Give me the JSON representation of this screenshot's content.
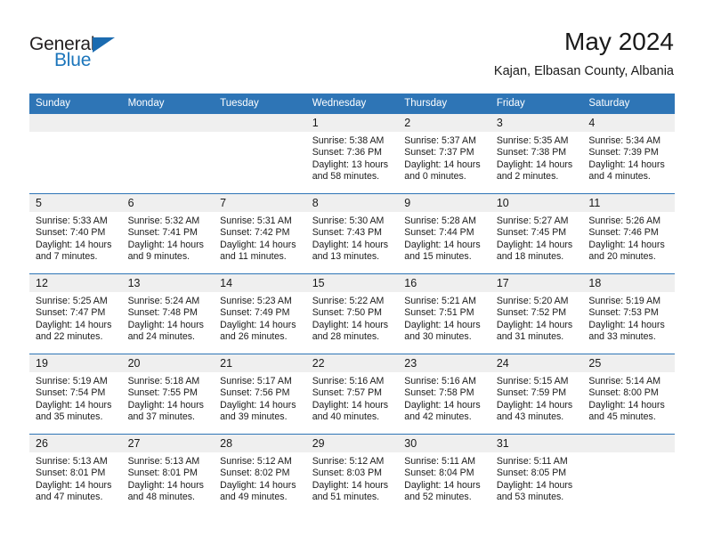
{
  "brand": {
    "line1": "General",
    "line2": "Blue",
    "accent_color": "#1b75bb",
    "triangle_color": "#1b6bb0"
  },
  "header": {
    "title": "May 2024",
    "subtitle": "Kajan, Elbasan County, Albania"
  },
  "theme": {
    "header_bg": "#2e75b6",
    "daynum_bg": "#efefef",
    "text_color": "#1a1a1a"
  },
  "weekday_headers": [
    "Sunday",
    "Monday",
    "Tuesday",
    "Wednesday",
    "Thursday",
    "Friday",
    "Saturday"
  ],
  "weeks": [
    [
      {
        "day": "",
        "lines": []
      },
      {
        "day": "",
        "lines": []
      },
      {
        "day": "",
        "lines": []
      },
      {
        "day": "1",
        "lines": [
          "Sunrise: 5:38 AM",
          "Sunset: 7:36 PM",
          "Daylight: 13 hours",
          "and 58 minutes."
        ]
      },
      {
        "day": "2",
        "lines": [
          "Sunrise: 5:37 AM",
          "Sunset: 7:37 PM",
          "Daylight: 14 hours",
          "and 0 minutes."
        ]
      },
      {
        "day": "3",
        "lines": [
          "Sunrise: 5:35 AM",
          "Sunset: 7:38 PM",
          "Daylight: 14 hours",
          "and 2 minutes."
        ]
      },
      {
        "day": "4",
        "lines": [
          "Sunrise: 5:34 AM",
          "Sunset: 7:39 PM",
          "Daylight: 14 hours",
          "and 4 minutes."
        ]
      }
    ],
    [
      {
        "day": "5",
        "lines": [
          "Sunrise: 5:33 AM",
          "Sunset: 7:40 PM",
          "Daylight: 14 hours",
          "and 7 minutes."
        ]
      },
      {
        "day": "6",
        "lines": [
          "Sunrise: 5:32 AM",
          "Sunset: 7:41 PM",
          "Daylight: 14 hours",
          "and 9 minutes."
        ]
      },
      {
        "day": "7",
        "lines": [
          "Sunrise: 5:31 AM",
          "Sunset: 7:42 PM",
          "Daylight: 14 hours",
          "and 11 minutes."
        ]
      },
      {
        "day": "8",
        "lines": [
          "Sunrise: 5:30 AM",
          "Sunset: 7:43 PM",
          "Daylight: 14 hours",
          "and 13 minutes."
        ]
      },
      {
        "day": "9",
        "lines": [
          "Sunrise: 5:28 AM",
          "Sunset: 7:44 PM",
          "Daylight: 14 hours",
          "and 15 minutes."
        ]
      },
      {
        "day": "10",
        "lines": [
          "Sunrise: 5:27 AM",
          "Sunset: 7:45 PM",
          "Daylight: 14 hours",
          "and 18 minutes."
        ]
      },
      {
        "day": "11",
        "lines": [
          "Sunrise: 5:26 AM",
          "Sunset: 7:46 PM",
          "Daylight: 14 hours",
          "and 20 minutes."
        ]
      }
    ],
    [
      {
        "day": "12",
        "lines": [
          "Sunrise: 5:25 AM",
          "Sunset: 7:47 PM",
          "Daylight: 14 hours",
          "and 22 minutes."
        ]
      },
      {
        "day": "13",
        "lines": [
          "Sunrise: 5:24 AM",
          "Sunset: 7:48 PM",
          "Daylight: 14 hours",
          "and 24 minutes."
        ]
      },
      {
        "day": "14",
        "lines": [
          "Sunrise: 5:23 AM",
          "Sunset: 7:49 PM",
          "Daylight: 14 hours",
          "and 26 minutes."
        ]
      },
      {
        "day": "15",
        "lines": [
          "Sunrise: 5:22 AM",
          "Sunset: 7:50 PM",
          "Daylight: 14 hours",
          "and 28 minutes."
        ]
      },
      {
        "day": "16",
        "lines": [
          "Sunrise: 5:21 AM",
          "Sunset: 7:51 PM",
          "Daylight: 14 hours",
          "and 30 minutes."
        ]
      },
      {
        "day": "17",
        "lines": [
          "Sunrise: 5:20 AM",
          "Sunset: 7:52 PM",
          "Daylight: 14 hours",
          "and 31 minutes."
        ]
      },
      {
        "day": "18",
        "lines": [
          "Sunrise: 5:19 AM",
          "Sunset: 7:53 PM",
          "Daylight: 14 hours",
          "and 33 minutes."
        ]
      }
    ],
    [
      {
        "day": "19",
        "lines": [
          "Sunrise: 5:19 AM",
          "Sunset: 7:54 PM",
          "Daylight: 14 hours",
          "and 35 minutes."
        ]
      },
      {
        "day": "20",
        "lines": [
          "Sunrise: 5:18 AM",
          "Sunset: 7:55 PM",
          "Daylight: 14 hours",
          "and 37 minutes."
        ]
      },
      {
        "day": "21",
        "lines": [
          "Sunrise: 5:17 AM",
          "Sunset: 7:56 PM",
          "Daylight: 14 hours",
          "and 39 minutes."
        ]
      },
      {
        "day": "22",
        "lines": [
          "Sunrise: 5:16 AM",
          "Sunset: 7:57 PM",
          "Daylight: 14 hours",
          "and 40 minutes."
        ]
      },
      {
        "day": "23",
        "lines": [
          "Sunrise: 5:16 AM",
          "Sunset: 7:58 PM",
          "Daylight: 14 hours",
          "and 42 minutes."
        ]
      },
      {
        "day": "24",
        "lines": [
          "Sunrise: 5:15 AM",
          "Sunset: 7:59 PM",
          "Daylight: 14 hours",
          "and 43 minutes."
        ]
      },
      {
        "day": "25",
        "lines": [
          "Sunrise: 5:14 AM",
          "Sunset: 8:00 PM",
          "Daylight: 14 hours",
          "and 45 minutes."
        ]
      }
    ],
    [
      {
        "day": "26",
        "lines": [
          "Sunrise: 5:13 AM",
          "Sunset: 8:01 PM",
          "Daylight: 14 hours",
          "and 47 minutes."
        ]
      },
      {
        "day": "27",
        "lines": [
          "Sunrise: 5:13 AM",
          "Sunset: 8:01 PM",
          "Daylight: 14 hours",
          "and 48 minutes."
        ]
      },
      {
        "day": "28",
        "lines": [
          "Sunrise: 5:12 AM",
          "Sunset: 8:02 PM",
          "Daylight: 14 hours",
          "and 49 minutes."
        ]
      },
      {
        "day": "29",
        "lines": [
          "Sunrise: 5:12 AM",
          "Sunset: 8:03 PM",
          "Daylight: 14 hours",
          "and 51 minutes."
        ]
      },
      {
        "day": "30",
        "lines": [
          "Sunrise: 5:11 AM",
          "Sunset: 8:04 PM",
          "Daylight: 14 hours",
          "and 52 minutes."
        ]
      },
      {
        "day": "31",
        "lines": [
          "Sunrise: 5:11 AM",
          "Sunset: 8:05 PM",
          "Daylight: 14 hours",
          "and 53 minutes."
        ]
      },
      {
        "day": "",
        "lines": []
      }
    ]
  ]
}
